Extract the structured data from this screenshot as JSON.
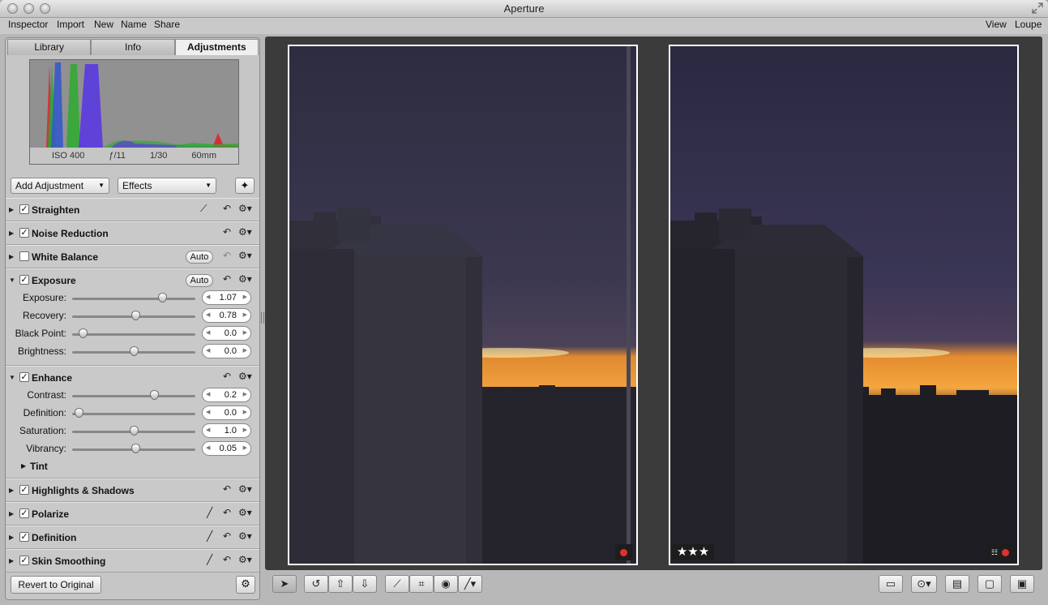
{
  "window": {
    "title": "Aperture"
  },
  "menubar": {
    "left": [
      "Inspector",
      "Import",
      "New",
      "Name",
      "Share"
    ],
    "right": [
      "View",
      "Loupe"
    ]
  },
  "inspector": {
    "tabs": [
      "Library",
      "Info",
      "Adjustments"
    ],
    "active_tab": "Adjustments",
    "histogram_info": {
      "iso": "ISO 400",
      "aperture": "ƒ/11",
      "shutter": "1/30",
      "focal": "60mm"
    },
    "add_adjustment": "Add Adjustment",
    "effects": "Effects",
    "auto_label": "Auto",
    "revert_label": "Revert to Original",
    "sections": {
      "straighten": {
        "label": "Straighten",
        "checked": true
      },
      "noise": {
        "label": "Noise Reduction",
        "checked": true
      },
      "white_balance": {
        "label": "White Balance",
        "checked": false
      },
      "exposure": {
        "label": "Exposure",
        "checked": true
      },
      "enhance": {
        "label": "Enhance",
        "checked": true
      },
      "highlights": {
        "label": "Highlights & Shadows",
        "checked": true
      },
      "polarize": {
        "label": "Polarize",
        "checked": true
      },
      "definition": {
        "label": "Definition",
        "checked": true
      },
      "skin": {
        "label": "Skin Smoothing",
        "checked": true
      }
    },
    "sliders": {
      "exposure": {
        "label": "Exposure:",
        "value": "1.07",
        "level": 0.75
      },
      "recovery": {
        "label": "Recovery:",
        "value": "0.78",
        "level": 0.52
      },
      "black_point": {
        "label": "Black Point:",
        "value": "0.0",
        "level": 0.06
      },
      "brightness": {
        "label": "Brightness:",
        "value": "0.0",
        "level": 0.5
      },
      "contrast": {
        "label": "Contrast:",
        "value": "0.2",
        "level": 0.68
      },
      "definition": {
        "label": "Definition:",
        "value": "0.0",
        "level": 0.02
      },
      "saturation": {
        "label": "Saturation:",
        "value": "1.0",
        "level": 0.5
      },
      "vibrancy": {
        "label": "Vibrancy:",
        "value": "0.05",
        "level": 0.52
      }
    },
    "tint_label": "Tint"
  },
  "viewer": {
    "left_photo": {
      "label_color": "#e03030"
    },
    "right_photo": {
      "rating": "★★★",
      "label_color": "#e03030"
    }
  },
  "icons": [
    "traffic-light",
    "straighten-icon",
    "undo-icon",
    "gear-icon",
    "brush-icon",
    "magic-wand-icon",
    "selection-arrow-icon",
    "rotate-left-icon",
    "lift-icon",
    "stamp-icon",
    "crop-icon",
    "red-eye-icon",
    "retouch-brush-icon"
  ]
}
